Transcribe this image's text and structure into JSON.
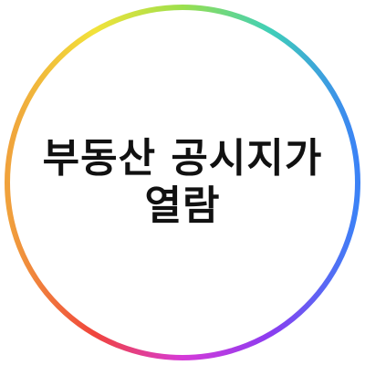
{
  "thumbnail": {
    "title_line1": "부동산 공시지가",
    "title_line2": "열람",
    "ring_colors": {
      "yellow": "#f5e63c",
      "green": "#8fe04a",
      "teal": "#3ad2c0",
      "blue": "#3b82f6",
      "purple": "#8b3cf0",
      "magenta": "#d63ad8",
      "red": "#f0443c",
      "orange": "#f59a3c"
    },
    "text_color": "#111111",
    "background_color": "#ffffff"
  }
}
